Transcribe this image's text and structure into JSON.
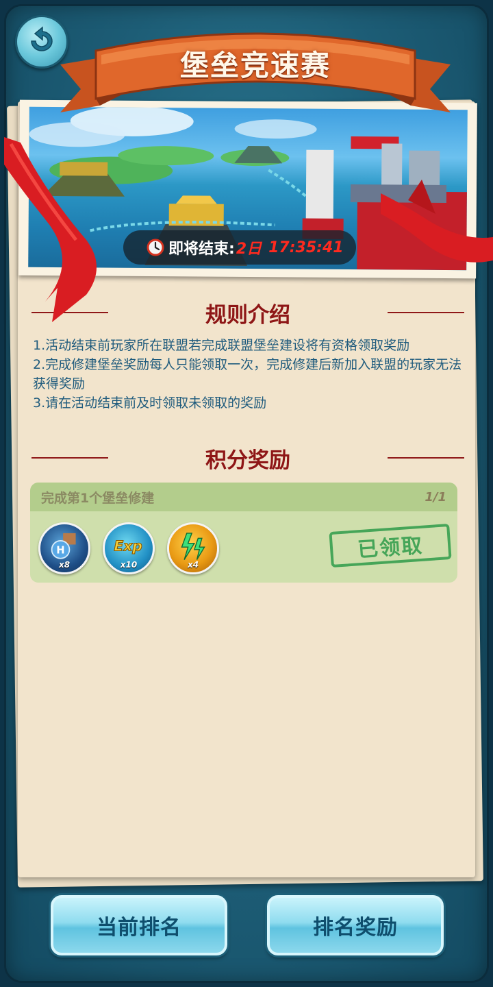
{
  "header": {
    "title": "堡垒竞速赛"
  },
  "banner": {
    "timer_label": "即将结束:",
    "timer_days": "2日",
    "timer_time": "17:35:41"
  },
  "rules": {
    "heading": "规则介绍",
    "items": [
      "1.活动结束前玩家所在联盟若完成联盟堡垒建设将有资格领取奖励",
      "2.完成修建堡垒奖励每人只能领取一次，完成修建后新加入联盟的玩家无法获得奖励",
      "3.请在活动结束前及时领取未领取的奖励"
    ]
  },
  "points_reward": {
    "heading": "积分奖励",
    "task": {
      "title": "完成第1个堡垒修建",
      "progress": "1/1",
      "stamp": "已领取",
      "rewards": [
        {
          "icon": "h-building-icon",
          "qty": "x8"
        },
        {
          "icon": "exp-icon",
          "qty": "x10"
        },
        {
          "icon": "energy-icon",
          "qty": "x4"
        }
      ]
    }
  },
  "footer": {
    "current_rank_label": "当前排名",
    "rank_reward_label": "排名奖励"
  },
  "colors": {
    "heading_red": "#8e1616",
    "rule_text": "#1f5b7d",
    "timer_red": "#ff2a1f",
    "stamp_green": "#2f9c4a"
  }
}
